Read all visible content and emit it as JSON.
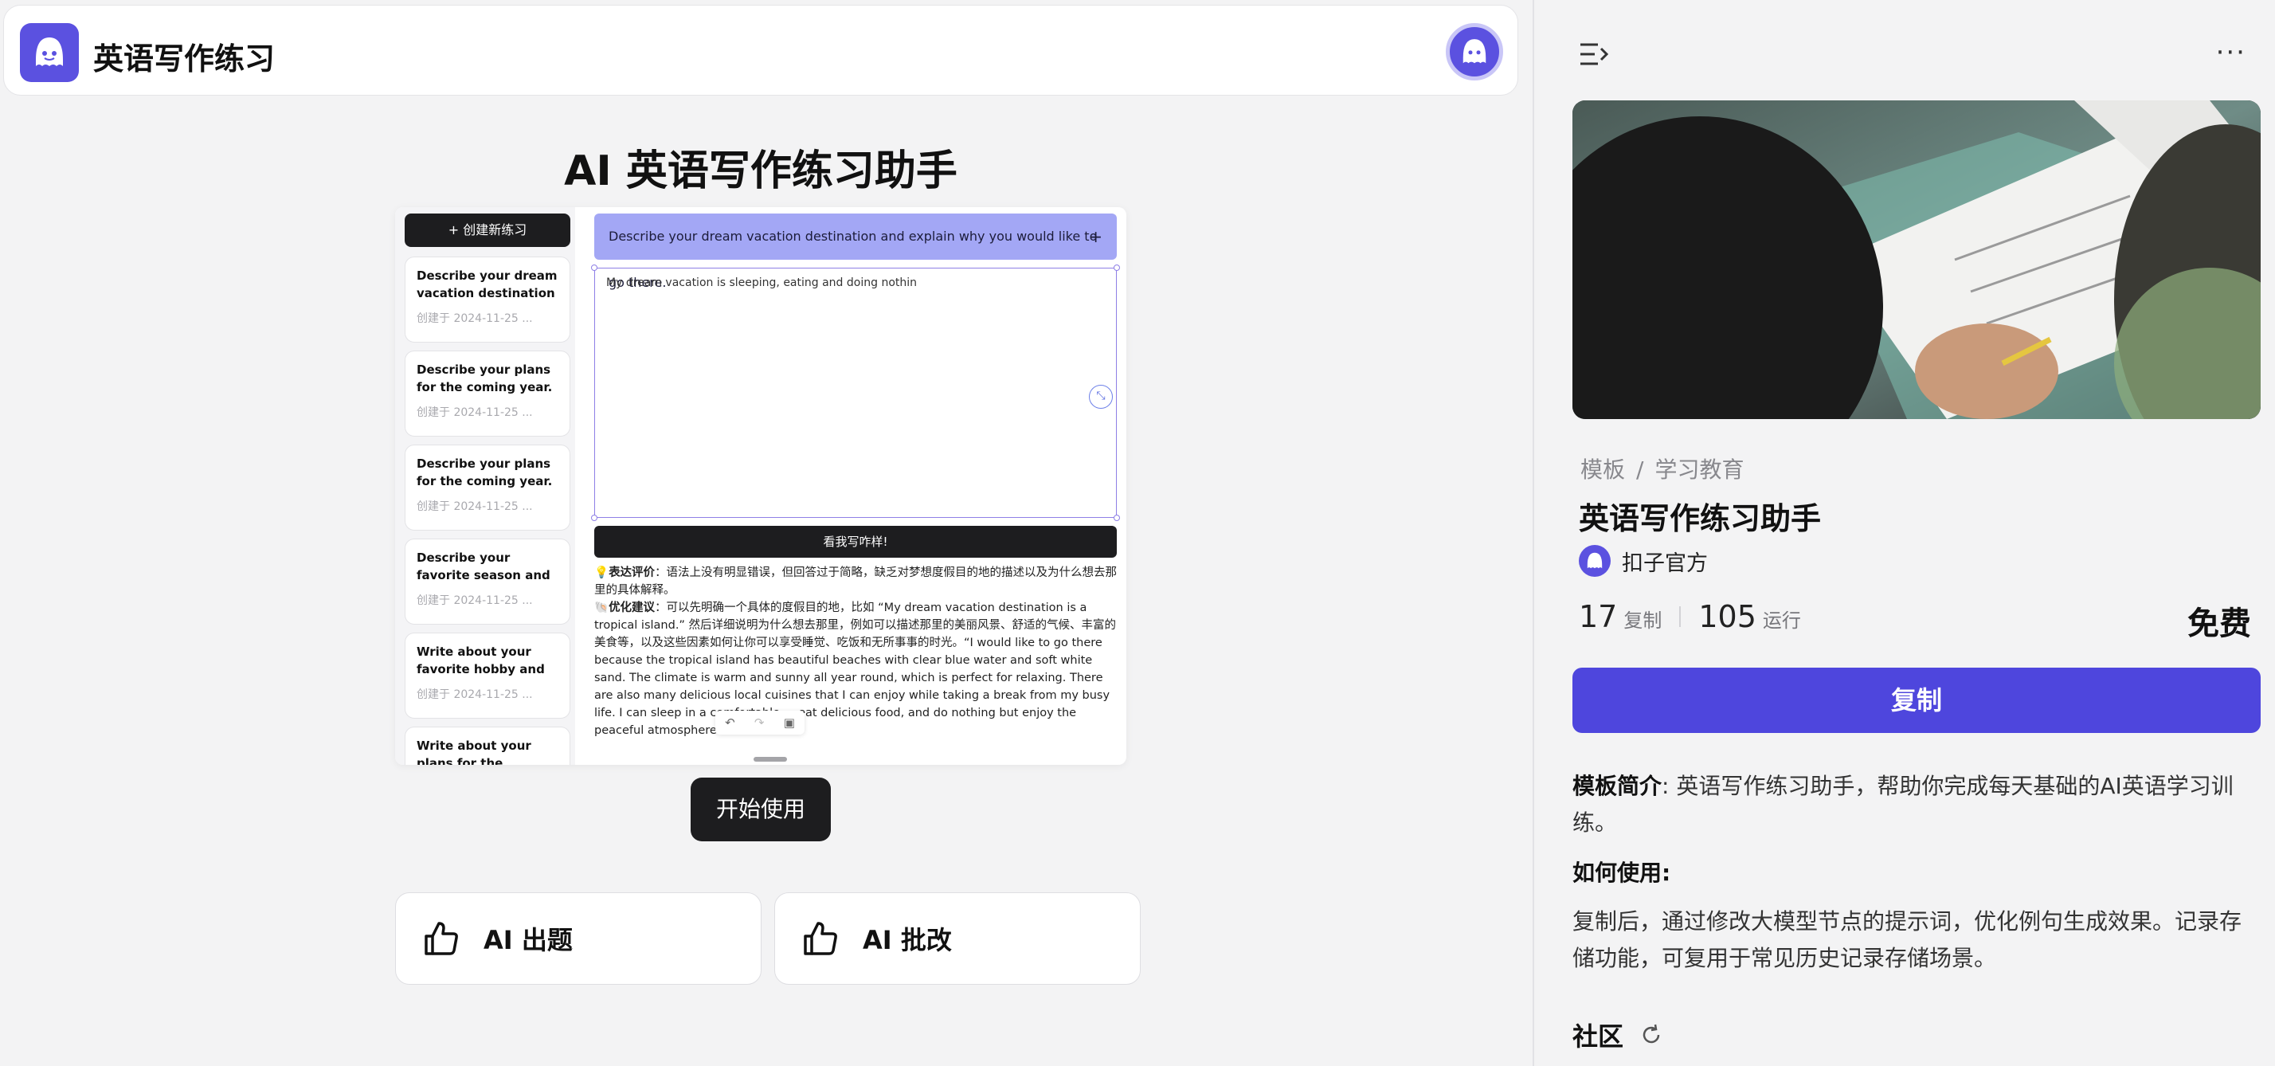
{
  "app": {
    "title": "英语写作练习",
    "avatar_icon": "bot-avatar-icon",
    "logo_icon": "bot-logo-icon",
    "brand_color": "#5b51e0"
  },
  "hero": {
    "title": "AI 英语写作练习助手"
  },
  "preview": {
    "new_button": "+ 创建新练习",
    "cards": [
      {
        "title": "Describe your dream vacation destination ...",
        "date": "创建于 2024-11-25 ..."
      },
      {
        "title": "Describe your plans for the coming year.",
        "date": "创建于 2024-11-25 ..."
      },
      {
        "title": "Describe your plans for the coming year.",
        "date": "创建于 2024-11-25 ..."
      },
      {
        "title": "Describe your favorite season and explain w...",
        "date": "创建于 2024-11-25 ..."
      },
      {
        "title": "Write about your favorite hobby and wh...",
        "date": "创建于 2024-11-25 ..."
      },
      {
        "title": "Write about your plans for the coming...",
        "date": ""
      }
    ],
    "prompt": "Describe your dream vacation destination and explain why you would like to go there.",
    "prompt_add": "+",
    "editor_text": "My dream vacation is sleeping, eating and doing nothin",
    "submit_label": "看我写咋样!",
    "feedback": {
      "eval_label": "表达评价",
      "eval_text": "：语法上没有明显错误，但回答过于简略，缺乏对梦想度假目的地的描述以及为什么想去那里的具体解释。",
      "suggest_label": "优化建议",
      "suggest_text": "：可以先明确一个具体的度假目的地，比如 “My dream vacation destination is a tropical island.” 然后详细说明为什么想去那里，例如可以描述那里的美丽风景、舒适的气候、丰富的美食等，以及这些因素如何让你可以享受睡觉、吃饭和无所事事的时光。“I would like to go there because the tropical island has beautiful beaches with clear blue water and soft white sand. The climate is warm and sunny all year round, which is perfect for relaxing. There are also many delicious local cuisines that I can enjoy while taking a break from my busy life. I can sleep in a comfortable ... eat delicious food, and do nothing but enjoy the peaceful atmosphere.”"
    }
  },
  "start_button": "开始使用",
  "features": [
    {
      "label": "AI 出题",
      "icon": "thumbs-up-icon"
    },
    {
      "label": "AI 批改",
      "icon": "thumbs-up-icon"
    }
  ],
  "panel": {
    "breadcrumb": [
      "模板",
      "学习教育"
    ],
    "breadcrumb_sep": "/",
    "title": "英语写作练习助手",
    "author": "扣子官方",
    "copies_num": "17",
    "copies_label": "复制",
    "runs_num": "105",
    "runs_label": "运行",
    "price": "免费",
    "copy_button": "复制",
    "desc_label": "模板简介",
    "desc_text": ": 英语写作练习助手，帮助你完成每天基础的AI英语学习训练。",
    "howto_label": "如何使用:",
    "howto_text": "复制后，通过修改大模型节点的提示词，优化例句生成效果。记录存储功能，可复用于常见历史记录存储场景。",
    "community_label": "社区",
    "accent_color": "#4e46dd"
  }
}
